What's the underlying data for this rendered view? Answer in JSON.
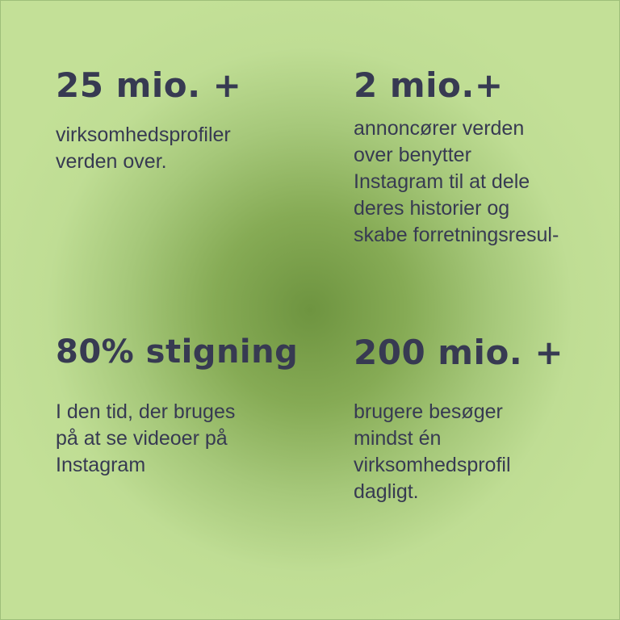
{
  "stats": [
    {
      "heading": "25 mio. +",
      "body": "virksomhedsprofiler\nverden over."
    },
    {
      "heading": "2 mio.+",
      "body": "annoncører verden\nover benytter\nInstagram til at dele\nderes historier og\nskabe forretningsresul-"
    },
    {
      "heading": "80% stigning",
      "body": "I den tid, der bruges\npå at se videoer på\nInstagram"
    },
    {
      "heading": "200 mio. +",
      "body": "brugere besøger\nmindst én\nvirksomhedsprofil\ndagligt."
    }
  ]
}
